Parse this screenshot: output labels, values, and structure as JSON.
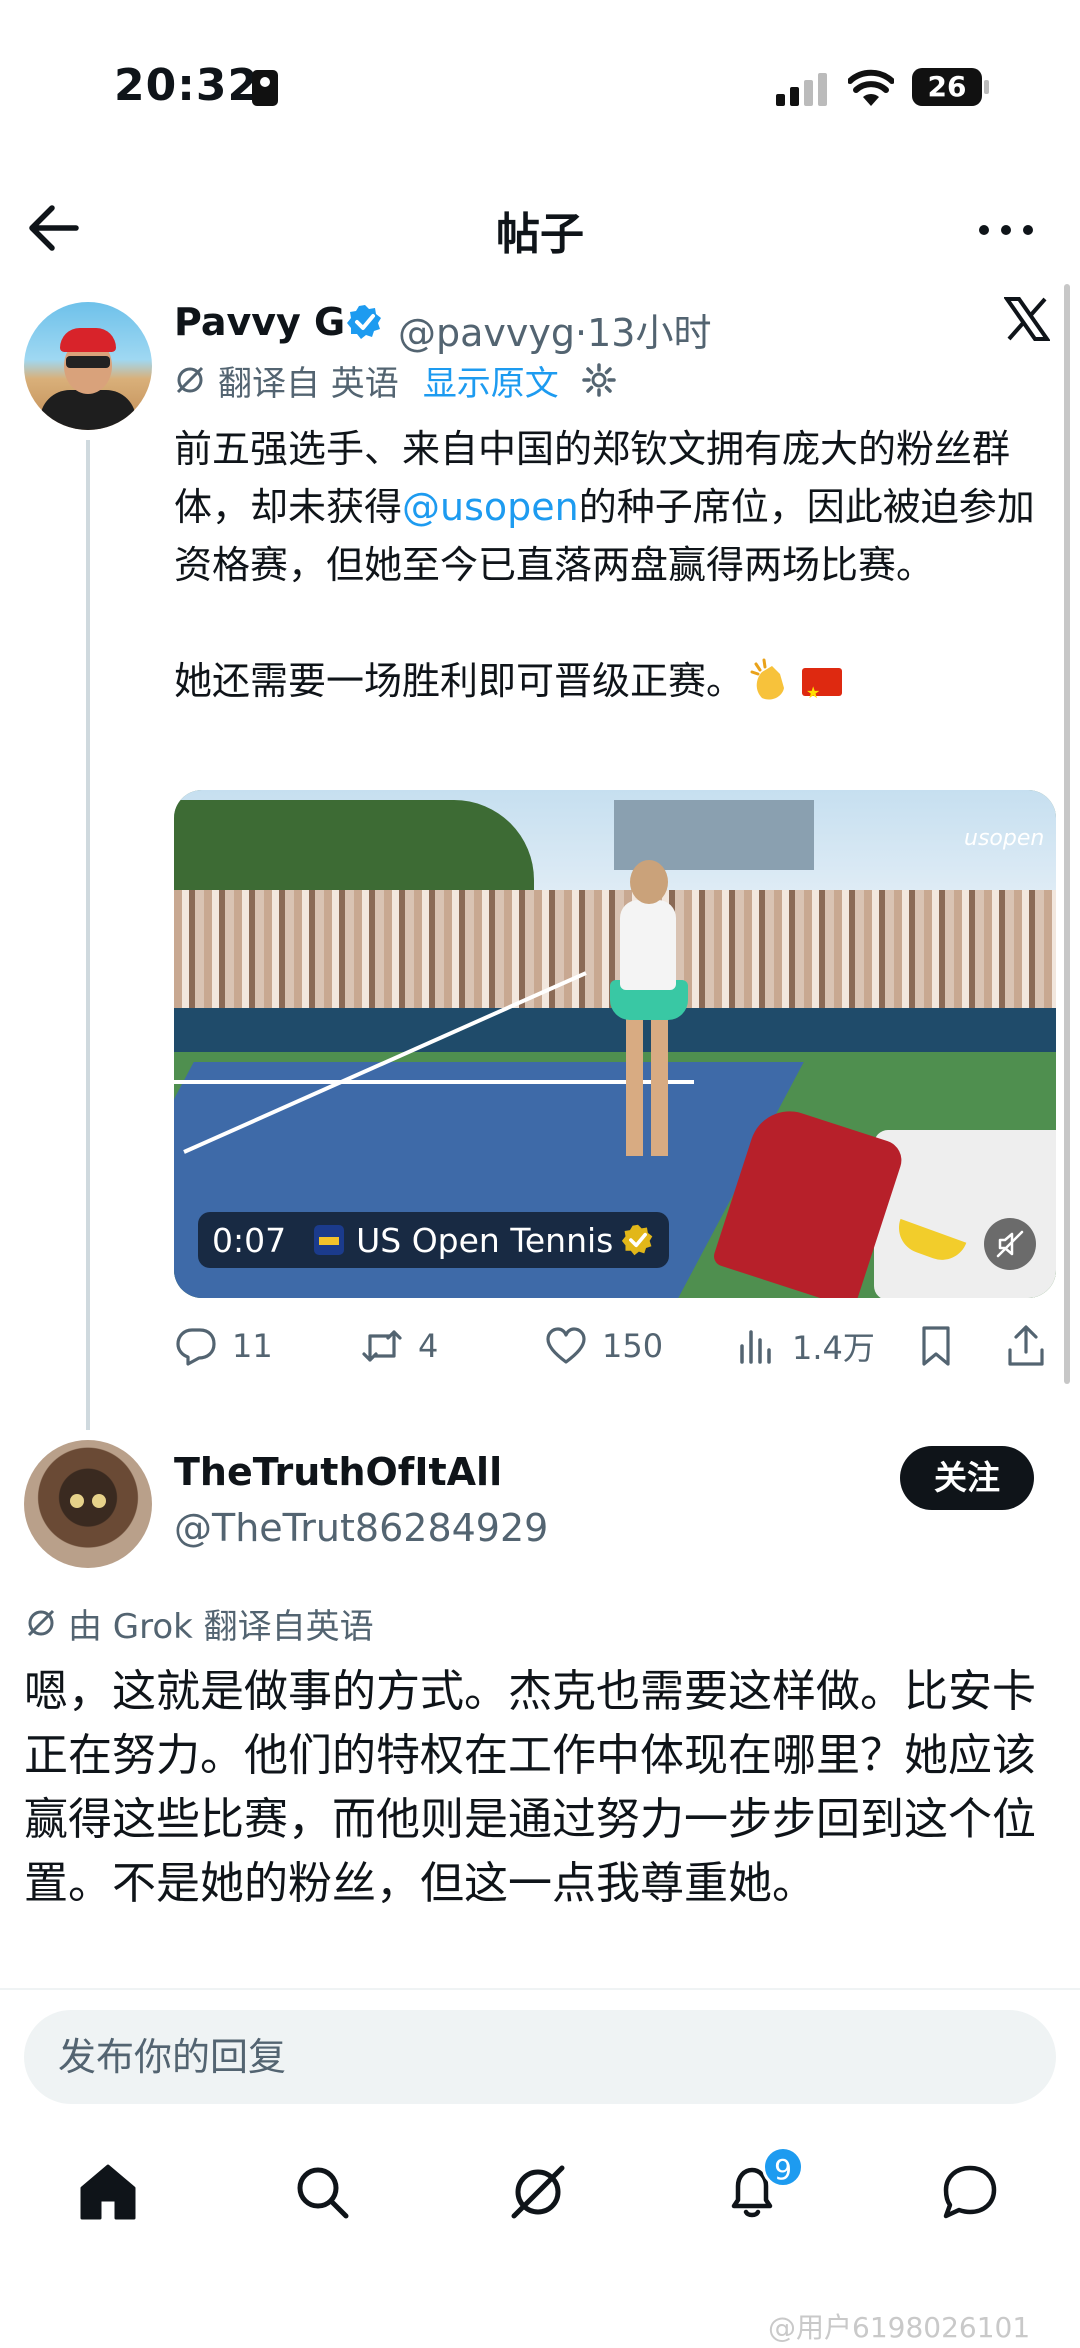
{
  "status_bar": {
    "time": "20:32",
    "battery": "26"
  },
  "header": {
    "title": "帖子"
  },
  "post": {
    "author_name": "Pavvy G",
    "handle": "@pavvyg",
    "separator": "·",
    "time_ago": "13小时",
    "translated_from": "翻译自 英语",
    "show_original": "显示原文",
    "text_before_mention": "前五强选手、来自中国的郑钦文拥有庞大的粉丝群体，却未获得",
    "mention": "@usopen",
    "text_after_mention": "的种子席位，因此被迫参加资格赛，但她至今已直落两盘赢得两场比赛。",
    "text_second_paragraph": "她还需要一场胜利即可晋级正赛。",
    "video": {
      "duration": "0:07",
      "source": "US Open Tennis",
      "watermark": "usopen"
    },
    "actions": {
      "replies": "11",
      "reposts": "4",
      "likes": "150",
      "views": "1.4万"
    }
  },
  "reply": {
    "author_name": "TheTruthOfItAll",
    "handle": "@TheTrut86284929",
    "follow_label": "关注",
    "grok_translation": "由 Grok 翻译自英语",
    "text": "嗯，这就是做事的方式。杰克也需要这样做。比安卡正在努力。他们的特权在工作中体现在哪里？她应该赢得这些比赛，而他则是通过努力一步步回到这个位置。不是她的粉丝，但这一点我尊重她。"
  },
  "compose": {
    "placeholder": "发布你的回复"
  },
  "bottom_nav": {
    "notification_count": "9"
  },
  "watermark": "@用户6198026101",
  "colors": {
    "accent": "#1d9bf0",
    "text": "#0f1419",
    "secondary": "#536471",
    "verified": "#1d9bf0",
    "gold": "#e2b719"
  }
}
